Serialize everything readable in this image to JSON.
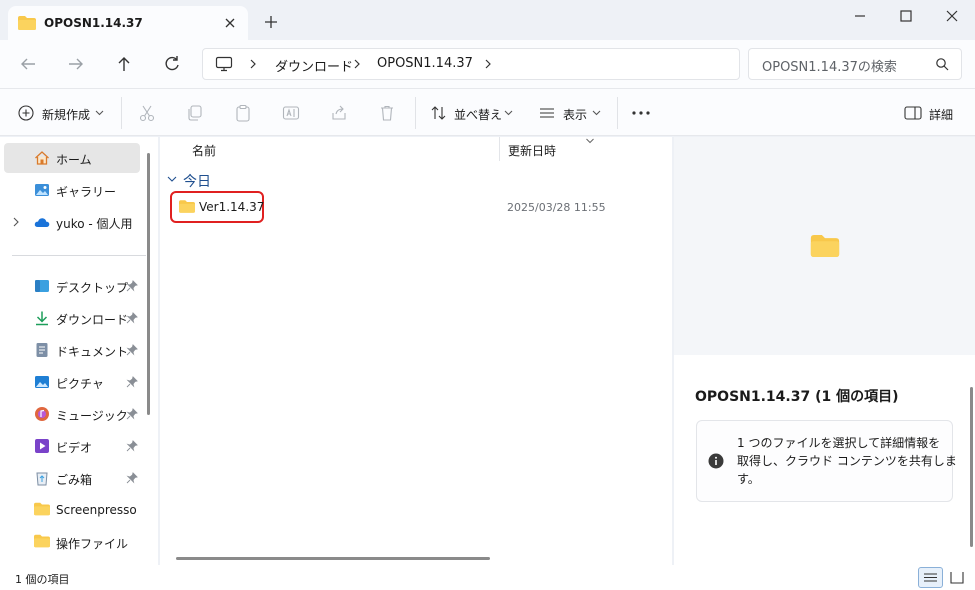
{
  "window": {
    "tab_title": "OPOSN1.14.37"
  },
  "address": {
    "crumbs": [
      "ダウンロード",
      "OPOSN1.14.37"
    ],
    "search_placeholder": "OPOSN1.14.37の検索"
  },
  "toolbar": {
    "new_label": "新規作成",
    "sort_label": "並べ替え",
    "view_label": "表示",
    "details_label": "詳細"
  },
  "sidebar": {
    "home": "ホーム",
    "gallery": "ギャラリー",
    "onedrive": "yuko - 個人用",
    "quick": [
      {
        "label": "デスクトップ",
        "icon": "desktop-icon"
      },
      {
        "label": "ダウンロード",
        "icon": "download-icon"
      },
      {
        "label": "ドキュメント",
        "icon": "document-icon"
      },
      {
        "label": "ピクチャ",
        "icon": "picture-icon"
      },
      {
        "label": "ミュージック",
        "icon": "music-icon"
      },
      {
        "label": "ビデオ",
        "icon": "video-icon"
      },
      {
        "label": "ごみ箱",
        "icon": "recycle-bin-icon"
      },
      {
        "label": "Screenpresso",
        "icon": "folder-icon"
      },
      {
        "label": "操作ファイル",
        "icon": "folder-icon"
      }
    ]
  },
  "list": {
    "col_name": "名前",
    "col_modified": "更新日時",
    "group_label": "今日",
    "rows": [
      {
        "name": "Ver1.14.37",
        "modified": "2025/03/28 11:55"
      }
    ]
  },
  "details": {
    "title": "OPOSN1.14.37 (1 個の項目)",
    "info_lines": [
      "1 つのファイルを選択して詳細情報を",
      "取得し、クラウド コンテンツを共有しま",
      "す。"
    ]
  },
  "status": {
    "count": "1 個の項目"
  },
  "colors": {
    "accent": "#0067c0",
    "folder": "#f8c84b",
    "highlight": "#e02020"
  }
}
